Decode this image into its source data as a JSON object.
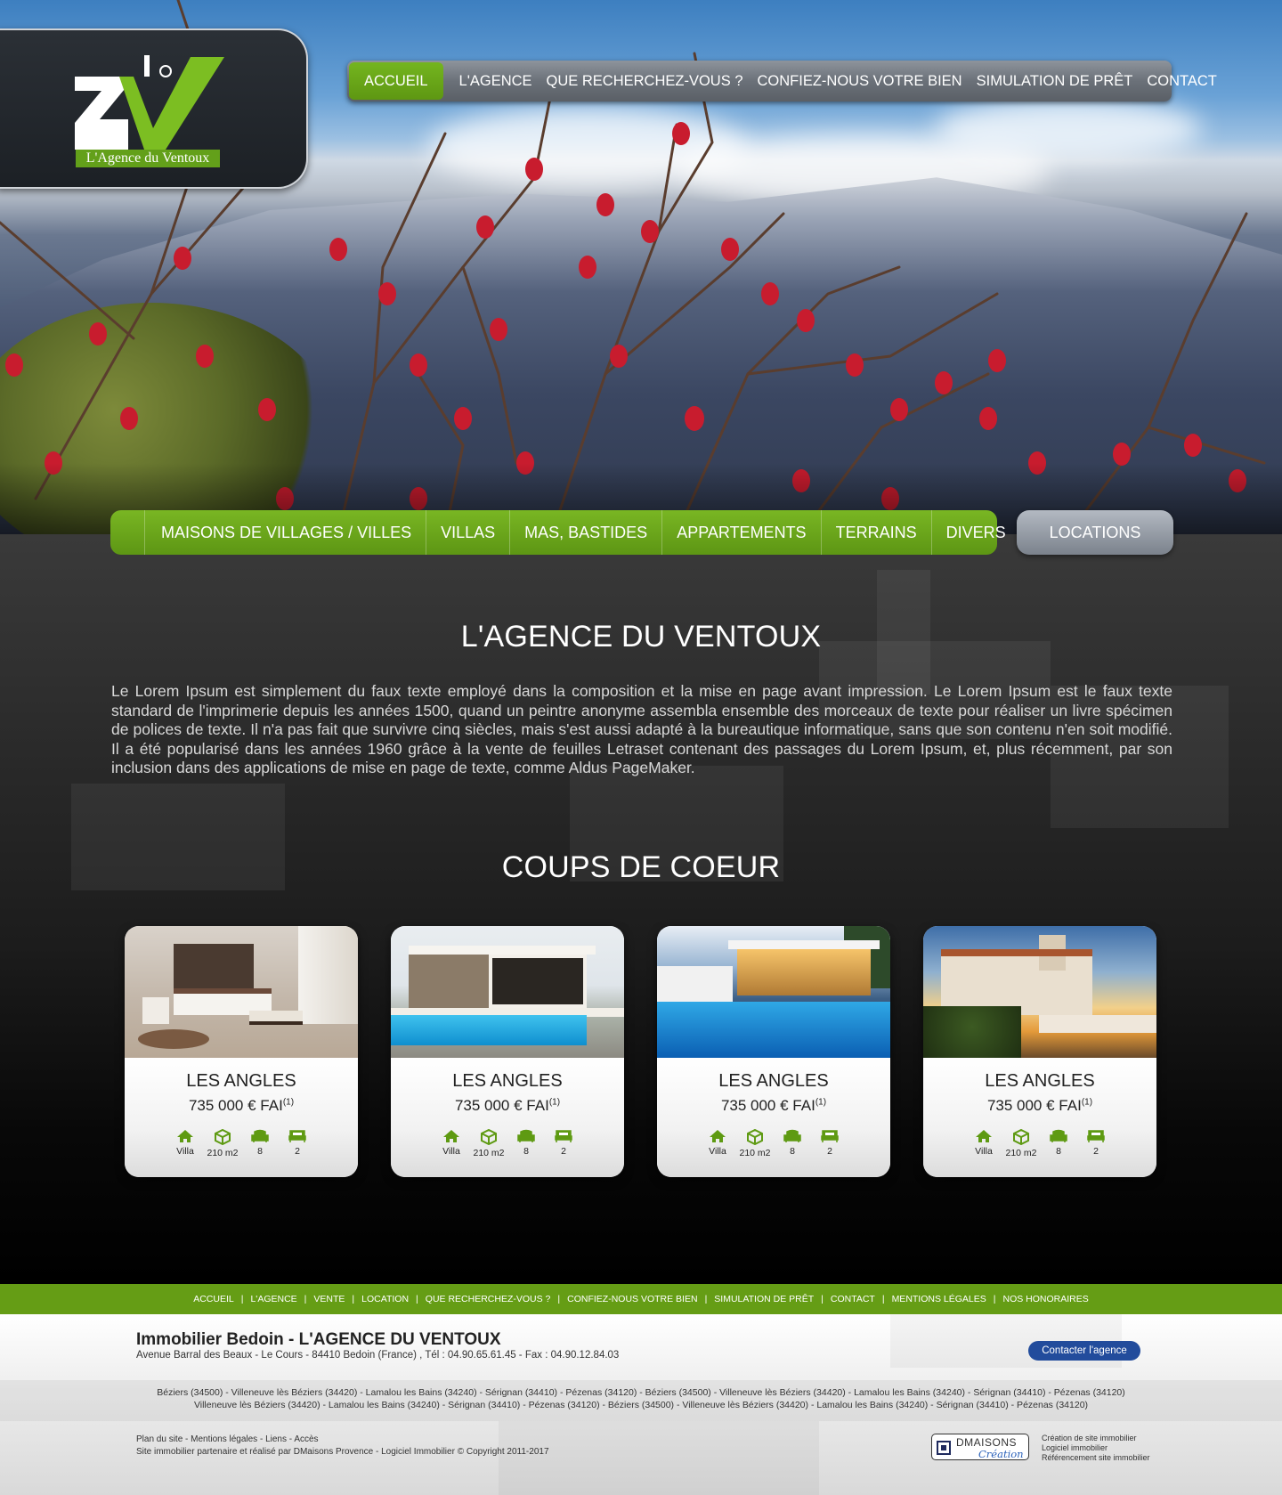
{
  "logo": {
    "letters": "ZV",
    "tagline": "L'Agence du Ventoux"
  },
  "topnav": {
    "items": [
      {
        "label": "ACCUEIL",
        "active": true
      },
      {
        "label": "L'AGENCE"
      },
      {
        "label": "QUE RECHERCHEZ-VOUS ?"
      },
      {
        "label": "CONFIEZ-NOUS VOTRE BIEN"
      },
      {
        "label": "SIMULATION DE PRÊT"
      },
      {
        "label": "CONTACT"
      }
    ]
  },
  "categories": {
    "items": [
      "MAISONS DE VILLAGES / VILLES",
      "VILLAS",
      "MAS, BASTIDES",
      "APPARTEMENTS",
      "TERRAINS",
      "DIVERS"
    ],
    "locations_label": "LOCATIONS"
  },
  "intro": {
    "title": "L'AGENCE DU VENTOUX",
    "text": "Le Lorem Ipsum est simplement du faux texte employé dans la composition et la mise en page avant impression. Le Lorem Ipsum est le faux texte standard de l'imprimerie depuis les années 1500, quand un peintre anonyme assembla ensemble des morceaux de texte pour réaliser un livre spécimen de polices de texte. Il n'a pas fait que survivre cinq siècles, mais s'est aussi adapté à la bureautique informatique, sans que son contenu n'en soit modifié. Il a été popularisé dans les années 1960 grâce à la vente de feuilles Letraset contenant des passages du Lorem Ipsum, et, plus récemment, par son inclusion dans des applications de mise en page de texte, comme Aldus PageMaker."
  },
  "favorites": {
    "title": "COUPS DE COEUR",
    "cards": [
      {
        "photo": "bedroom",
        "name": "LES ANGLES",
        "price": "735 000 € FAI",
        "note": "(1)",
        "type": "Villa",
        "area": "210 m2",
        "rooms": "8",
        "bedrooms": "2"
      },
      {
        "photo": "modern-house-pool",
        "name": "LES ANGLES",
        "price": "735 000 € FAI",
        "note": "(1)",
        "type": "Villa",
        "area": "210 m2",
        "rooms": "8",
        "bedrooms": "2"
      },
      {
        "photo": "villa-pool-night",
        "name": "LES ANGLES",
        "price": "735 000 € FAI",
        "note": "(1)",
        "type": "Villa",
        "area": "210 m2",
        "rooms": "8",
        "bedrooms": "2"
      },
      {
        "photo": "mediterranean-villa-sunset",
        "name": "LES ANGLES",
        "price": "735 000 € FAI",
        "note": "(1)",
        "type": "Villa",
        "area": "210 m2",
        "rooms": "8",
        "bedrooms": "2"
      }
    ]
  },
  "footer": {
    "nav": [
      "ACCUEIL",
      "L'AGENCE",
      "VENTE",
      "LOCATION",
      "QUE RECHERCHEZ-VOUS ?",
      "CONFIEZ-NOUS VOTRE BIEN",
      "SIMULATION DE PRÊT",
      "CONTACT",
      "MENTIONS LÉGALES",
      "NOS HONORAIRES"
    ],
    "agency_name": "Immobilier Bedoin - L'AGENCE DU VENTOUX",
    "address": "Avenue Barral des Beaux - Le Cours - 84410 Bedoin (France) , Tél : 04.90.65.61.45 - Fax : 04.90.12.84.03",
    "contact_button": "Contacter l'agence",
    "cities_line1": "Béziers (34500) - Villeneuve lès Béziers (34420) - Lamalou les Bains (34240) - Sérignan (34410) - Pézenas (34120) - Béziers (34500) - Villeneuve lès Béziers (34420) - Lamalou les Bains (34240) - Sérignan (34410) - Pézenas (34120)",
    "cities_line2": "Villeneuve lès Béziers (34420) - Lamalou les Bains (34240) - Sérignan (34410) - Pézenas (34120) - Béziers (34500) - Villeneuve lès Béziers (34420) - Lamalou les Bains (34240) - Sérignan (34410) - Pézenas (34120)",
    "links_line": "Plan du site - Mentions légales - Liens - Accès",
    "credits_line": "Site immobilier partenaire et réalisé par DMaisons Provence - Logiciel Immobilier © Copyright 2011-2017",
    "dm_logo_text1": "DMAISONS",
    "dm_logo_text2": "Création",
    "dm_lines": [
      "Création de site immobilier",
      "Logiciel immobilier",
      "Référencement site immobilier"
    ]
  },
  "colors": {
    "brand_green": "#659d15",
    "accent_blue": "#224c9c",
    "nav_gray": "#6b7179"
  },
  "icons": {
    "type": "house-icon",
    "area": "cube-icon",
    "rooms": "armchair-icon",
    "bedrooms": "bed-icon"
  }
}
